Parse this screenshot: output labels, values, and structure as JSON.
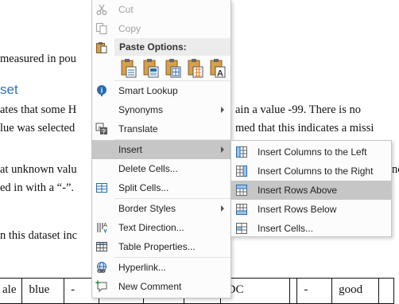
{
  "document": {
    "line1": "measured in pou",
    "heading": "set",
    "line2a": "ates that some H",
    "line2b": "ain a value -99.  There is no",
    "line3a": "lue was selected",
    "line3b": "med that this indicates a missi",
    "line4a": "at unknown valu",
    "line4b": "nc",
    "line5": "ed in with a “-”.",
    "line6": "n this dataset inc",
    "table_cells": [
      "ale",
      "blue",
      "-",
      "",
      "",
      "",
      "DC",
      "",
      "-",
      "good",
      ""
    ]
  },
  "context_menu": {
    "cut": "Cut",
    "copy": "Copy",
    "paste_options_title": "Paste Options:",
    "paste_buttons": [
      "keep-source-formatting",
      "merge-table",
      "nest-table",
      "insert-as-new-rows",
      "keep-text-only"
    ],
    "smart_lookup": "Smart Lookup",
    "synonyms": "Synonyms",
    "translate": "Translate",
    "insert": "Insert",
    "delete_cells": "Delete Cells...",
    "split_cells": "Split Cells...",
    "border_styles": "Border Styles",
    "text_direction": "Text Direction...",
    "table_properties": "Table Properties...",
    "hyperlink": "Hyperlink...",
    "new_comment": "New Comment"
  },
  "insert_submenu": {
    "columns_left": "Insert Columns to the Left",
    "columns_right": "Insert Columns to the Right",
    "rows_above": "Insert Rows Above",
    "rows_below": "Insert Rows Below",
    "cells": "Insert Cells..."
  },
  "colors": {
    "heading": "#2e74b5",
    "highlight": "#c6c6c6",
    "icon_blue": "#2b6cb0",
    "icon_orange": "#e07b24"
  }
}
